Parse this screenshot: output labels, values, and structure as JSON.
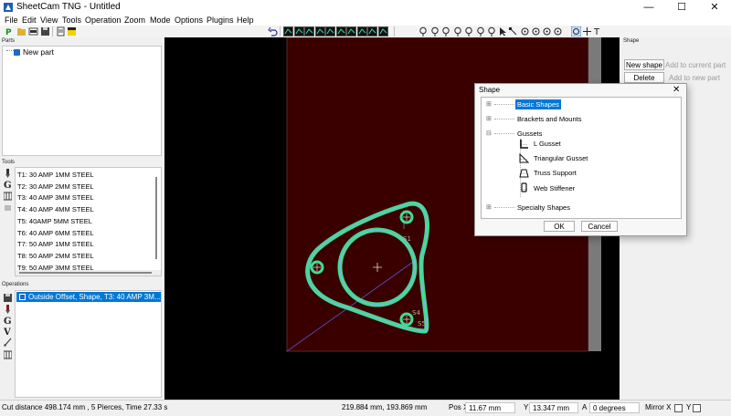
{
  "window": {
    "title": "SheetCam TNG - Untitled",
    "controls": [
      "—",
      "☐",
      "✕"
    ]
  },
  "menu": [
    "File",
    "Edit",
    "View",
    "Tools",
    "Operation",
    "Zoom",
    "Mode",
    "Options",
    "Plugins",
    "Help"
  ],
  "parts_panel": {
    "title": "Parts",
    "items": [
      {
        "label": "New part"
      }
    ]
  },
  "tools_panel": {
    "title": "Tools",
    "items": [
      "T1: 30 AMP 1MM STEEL",
      "T2: 30 AMP 2MM STEEL",
      "T3: 40 AMP 3MM STEEL",
      "T4: 40 AMP 4MM STEEL",
      "T5: 40AMP 5MM STEEL",
      "T6: 40 AMP 6MM STEEL",
      "T7: 50 AMP 1MM STEEL",
      "T8: 50 AMP 2MM STEEL",
      "T9: 50 AMP 3MM STEEL"
    ]
  },
  "operations_panel": {
    "title": "Operations",
    "items": [
      "Outside Offset, Shape, T3: 40 AMP 3M..."
    ]
  },
  "shape_panel": {
    "title": "Shape",
    "buttons": {
      "new_shape": "New shape",
      "add_to_current": "Add to current part",
      "delete": "Delete",
      "add_to_new": "Add to new part"
    }
  },
  "dialog": {
    "title": "Shape",
    "close": "✕",
    "tree": {
      "basic_shapes": "Basic Shapes",
      "brackets": "Brackets and Mounts",
      "gussets": "Gussets",
      "l_gusset": "L Gusset",
      "triangular_gusset": "Triangular Gusset",
      "truss_support": "Truss Support",
      "web_stiffener": "Web Stiffener",
      "specialty": "Specialty Shapes"
    },
    "ok": "OK",
    "cancel": "Cancel"
  },
  "canvas": {
    "labels": {
      "s1": "S1",
      "s4": "S4",
      "s5": "S5"
    }
  },
  "status": {
    "cut_info": "Cut distance 498.174 mm , 5 Pierces, Time 27.33 s",
    "coords": "219.884 mm, 193.869 mm",
    "pos_x_label": "Pos X",
    "pos_x": "11.67 mm",
    "y_label": "Y",
    "y": "13.347 mm",
    "a_label": "A",
    "a": "0 degrees",
    "mirror_x": "Mirror X",
    "mirror_y": "Y"
  },
  "colors": {
    "stock": "#3a0000",
    "toolpath": "#3fdc8f",
    "shape_outline": "#9fa0ff",
    "selection": "#0078d7"
  }
}
